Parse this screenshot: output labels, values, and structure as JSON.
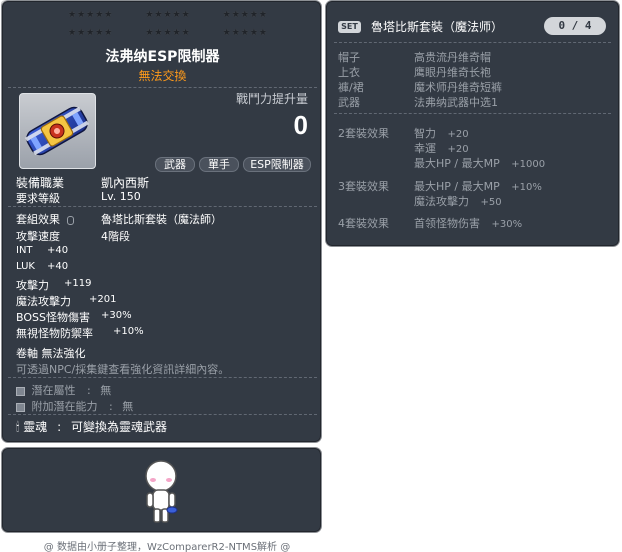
{
  "item_code": "01262056",
  "stars": {
    "row1": [
      "★★★★★",
      "★★★★★",
      "★★★★★"
    ],
    "row2": [
      "★★★★★",
      "★★★★★",
      "★★★★★"
    ]
  },
  "item": {
    "name": "法弗纳ESP限制器",
    "trade": "無法交換",
    "icon": "esp-limiter-bracelet-icon",
    "cp_label": "戰鬥力提升量",
    "cp_value": "0",
    "tags": [
      "武器",
      "單手",
      "ESP限制器"
    ],
    "job_label": "裝備職業",
    "job_value": "凱內西斯",
    "level_label": "要求等級",
    "level_value": "Lv. 150",
    "set_label": "套組效果",
    "set_value": "魯塔比斯套裝（魔法師）",
    "speed_label": "攻擊速度",
    "speed_value": "4階段",
    "stats": [
      {
        "label": "INT",
        "value": "+40"
      },
      {
        "label": "LUK",
        "value": "+40"
      },
      {
        "label": "攻擊力",
        "value": "+119"
      },
      {
        "label": "魔法攻擊力",
        "value": "+201"
      },
      {
        "label": "BOSS怪物傷害",
        "value": "+30%"
      },
      {
        "label": "無視怪物防禦率",
        "value": "+10%"
      }
    ],
    "scroll_text": "卷軸 無法強化",
    "hint_text": "可透過NPC/採集鍵查看強化資訊詳細內容。",
    "potential_label": "潛在屬性",
    "potential_value": "無",
    "add_potential_label": "附加潛在能力",
    "add_potential_value": "無",
    "soul_label": "靈魂",
    "soul_value": "可變換為靈魂武器",
    "colors": {
      "trade": "#ff9a1a",
      "panel": "#333a44",
      "secondary": "#9aa0a8"
    }
  },
  "set_panel": {
    "badge": "SET",
    "title": "魯塔比斯套裝（魔法师）",
    "count": "0 / 4",
    "pieces": [
      {
        "slot": "帽子",
        "name": "高贵流丹维奇帽"
      },
      {
        "slot": "上衣",
        "name": "鹰眼丹维奇长袍"
      },
      {
        "slot": "褲/裙",
        "name": "魔术师丹维奇短裤"
      },
      {
        "slot": "武器",
        "name": "法弗纳武器中选1"
      }
    ],
    "effects": [
      {
        "label": "2套裝效果",
        "stats": [
          {
            "name": "智力",
            "value": "+20"
          },
          {
            "name": "幸運",
            "value": "+20"
          },
          {
            "name": "最大HP / 最大MP",
            "value": "+1000"
          }
        ]
      },
      {
        "label": "3套裝效果",
        "stats": [
          {
            "name": "最大HP / 最大MP",
            "value": "+10%"
          },
          {
            "name": "魔法攻擊力",
            "value": "+50"
          }
        ]
      },
      {
        "label": "4套裝效果",
        "stats": [
          {
            "name": "首领怪物伤害",
            "value": "+30%"
          }
        ]
      }
    ]
  },
  "footer": "@ 数据由小册子整理，WzComparerR2-NTMS解析 @"
}
